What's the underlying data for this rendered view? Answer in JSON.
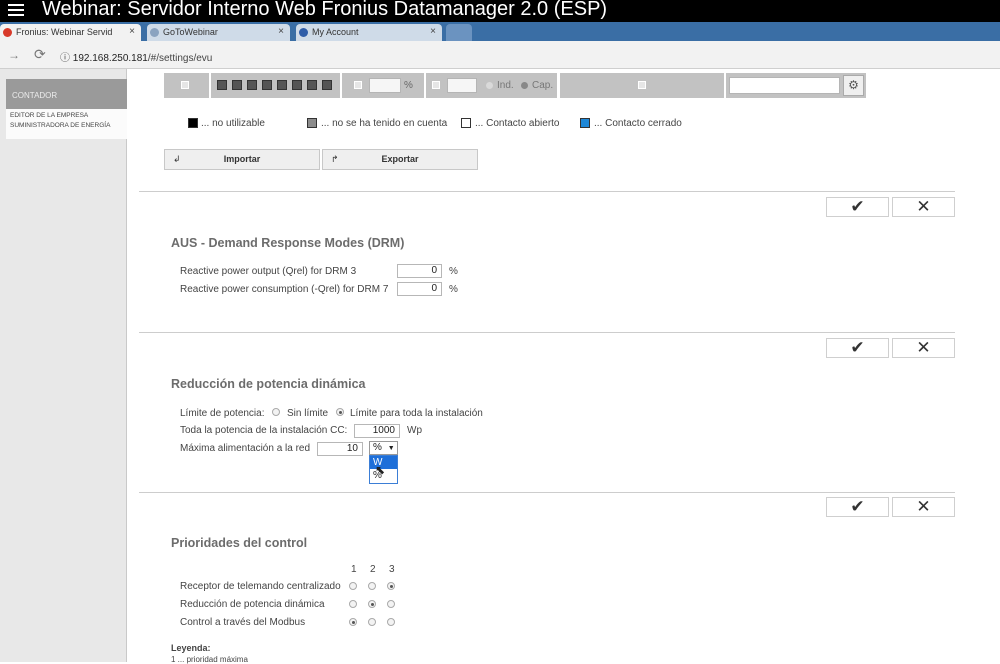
{
  "video": {
    "title": "Webinar: Servidor Interno Web Fronius Datamanager 2.0 (ESP)"
  },
  "browser": {
    "tabs": [
      {
        "label": "Fronius: Webinar Servid",
        "active": true
      },
      {
        "label": "GoToWebinar",
        "active": false
      },
      {
        "label": "My Account",
        "active": false
      }
    ],
    "close_glyph": "×",
    "url_host": "192.168.250.181",
    "url_path": "/#/settings/evu"
  },
  "sidebar": {
    "items": [
      {
        "label": "CONTADOR"
      },
      {
        "label_line1": "EDITOR DE LA EMPRESA",
        "label_line2": "SUMINISTRADORA DE ENERGÍA"
      }
    ]
  },
  "config_row": {
    "percent_unit": "%",
    "ind_label": "Ind.",
    "cap_label": "Cap.",
    "gear_glyph": "⚙"
  },
  "legend": {
    "not_usable": "... no utilizable",
    "not_considered": "... no se ha tenido en cuenta",
    "contact_open": "... Contacto abierto",
    "contact_closed": "... Contacto cerrado",
    "colors": {
      "not_usable": "#000000",
      "not_considered": "#8c8c8c",
      "contact_open": "#ffffff",
      "contact_closed": "#1e88d8"
    }
  },
  "actions": {
    "import_label": "Importar",
    "export_label": "Exportar",
    "ok_glyph": "✔",
    "cancel_glyph": "✕"
  },
  "drm": {
    "title": "AUS - Demand Response Modes (DRM)",
    "row1_label": "Reactive power output (Qrel) for DRM 3",
    "row1_value": "0",
    "row2_label": "Reactive power consumption (-Qrel) for DRM 7",
    "row2_value": "0",
    "unit": "%"
  },
  "dynamic": {
    "title": "Reducción de potencia dinámica",
    "limit_label": "Límite de potencia:",
    "option_no_limit": "Sin límite",
    "option_whole": "Límite para toda la instalación",
    "total_label": "Toda la potencia de la instalación CC:",
    "total_value": "1000",
    "total_unit": "Wp",
    "max_label": "Máxima alimentación a la red",
    "max_value": "10",
    "unit_selected": "%",
    "unit_caret": "▼",
    "unit_options": [
      "W",
      "%"
    ]
  },
  "priorities": {
    "title": "Prioridades del control",
    "columns": [
      "1",
      "2",
      "3"
    ],
    "rows": [
      {
        "label": "Receptor de telemando centralizado",
        "selected": 3
      },
      {
        "label": "Reducción de potencia dinámica",
        "selected": 2
      },
      {
        "label": "Control a través del Modbus",
        "selected": 1
      }
    ],
    "legend_title": "Leyenda:",
    "legend_line1": "1 ... prioridad máxima"
  }
}
